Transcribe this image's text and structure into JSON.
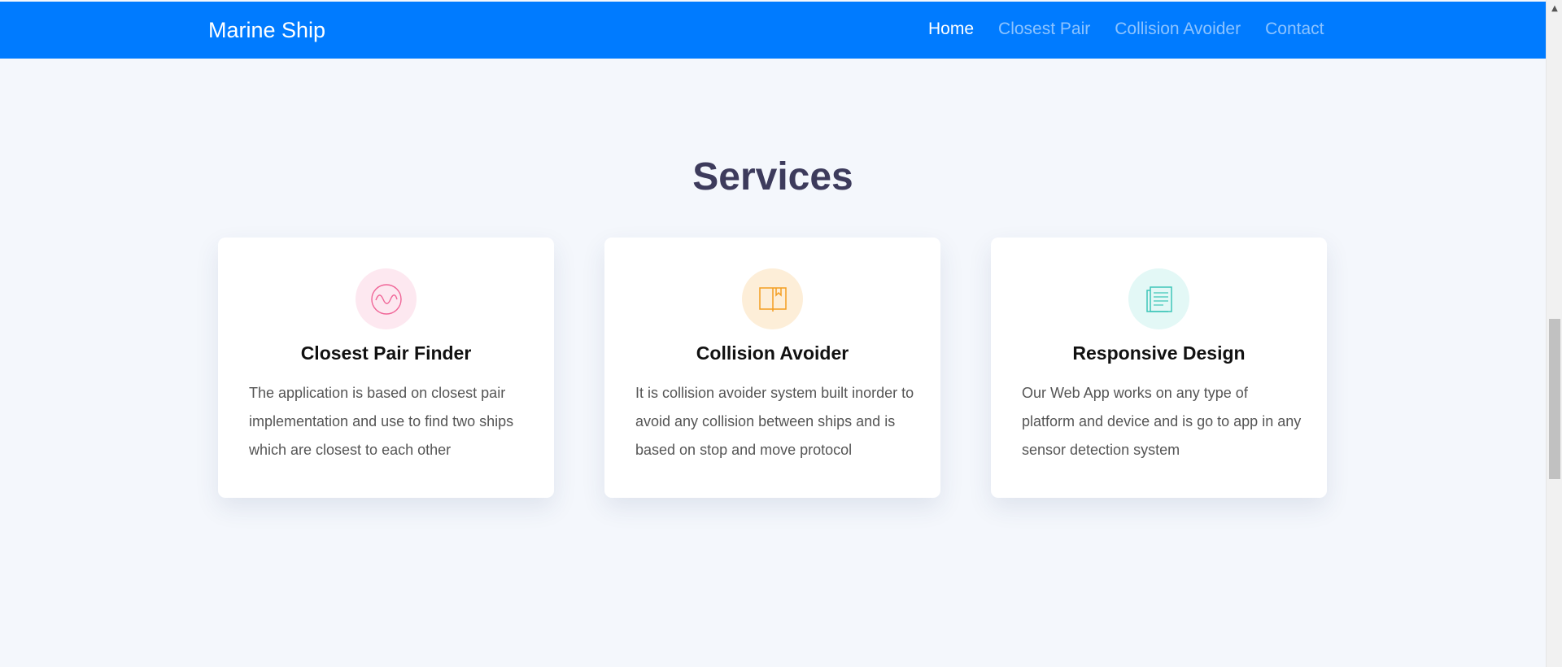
{
  "navbar": {
    "brand": "Marine Ship",
    "links": [
      {
        "label": "Home",
        "active": true
      },
      {
        "label": "Closest Pair",
        "active": false
      },
      {
        "label": "Collision Avoider",
        "active": false
      },
      {
        "label": "Contact",
        "active": false
      }
    ],
    "background_color": "#007bff"
  },
  "services": {
    "title": "Services",
    "cards": [
      {
        "icon": "wave-icon",
        "icon_color": "#f06597",
        "icon_bg": "#fde8f0",
        "title": "Closest Pair Finder",
        "text": "The application is based on closest pair implementation and use to find two ships which are closest to each other"
      },
      {
        "icon": "book-icon",
        "icon_color": "#f49d20",
        "icon_bg": "#fdeed8",
        "title": "Collision Avoider",
        "text": "It is collision avoider system built inorder to avoid any collision between ships and is based on stop and move protocol"
      },
      {
        "icon": "document-icon",
        "icon_color": "#3ec6b8",
        "icon_bg": "#e3f8f6",
        "title": "Responsive Design",
        "text": "Our Web App works on any type of platform and device and is go to app in any sensor detection system"
      }
    ]
  }
}
